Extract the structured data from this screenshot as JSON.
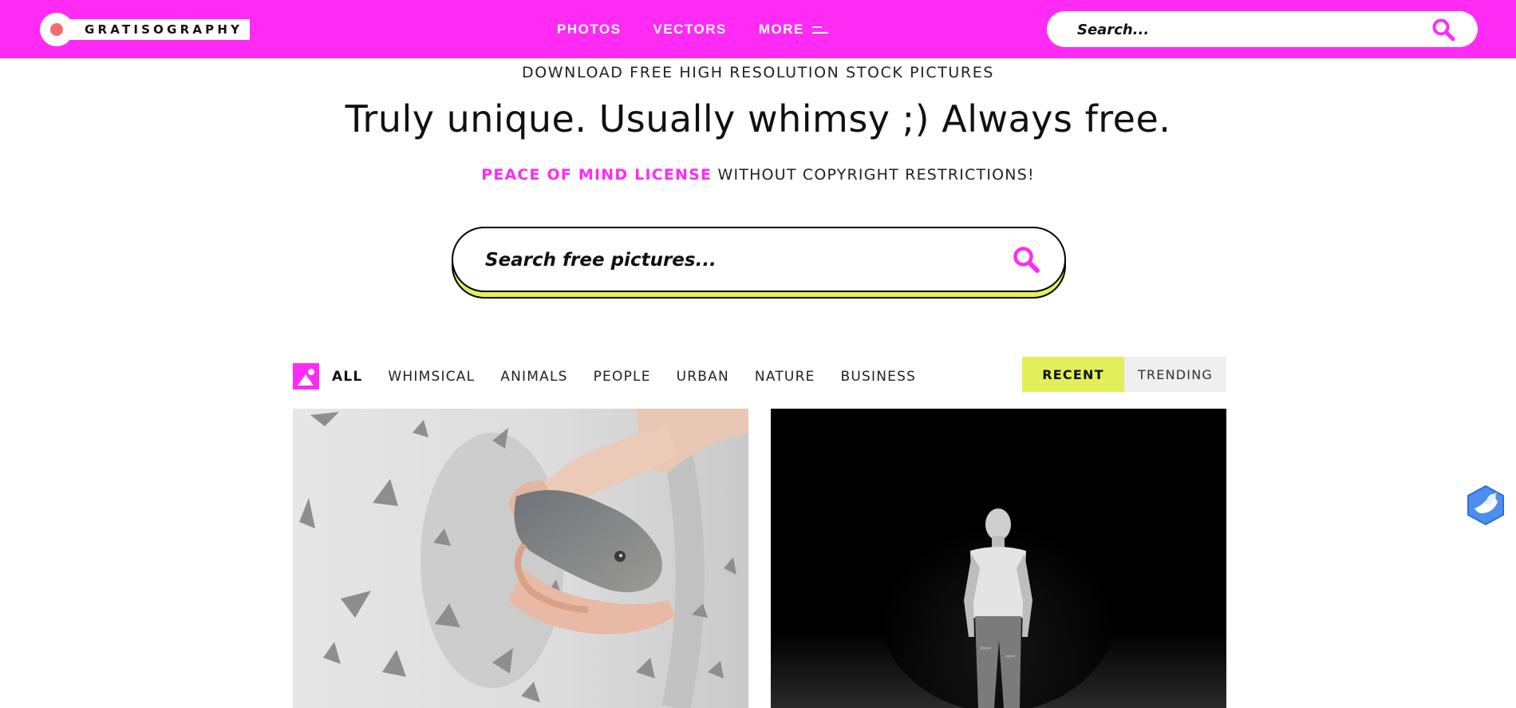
{
  "colors": {
    "brand": "#ff2bf4",
    "accent": "#e2ef5a",
    "logo_dot": "#f26d6d"
  },
  "header": {
    "logo_text": "GRATISOGRAPHY",
    "nav": {
      "photos": "PHOTOS",
      "vectors": "VECTORS",
      "more": "MORE"
    },
    "search": {
      "placeholder": "Search...",
      "icon": "search-icon"
    }
  },
  "hero": {
    "subhead": "DOWNLOAD FREE HIGH RESOLUTION STOCK PICTURES",
    "headline": "Truly unique. Usually whimsy ;) Always free.",
    "license_highlight": "PEACE OF MIND LICENSE",
    "license_rest": " WITHOUT COPYRIGHT RESTRICTIONS!",
    "search": {
      "placeholder": "Search free pictures...",
      "icon": "search-icon"
    }
  },
  "filters": {
    "category_icon": "image-icon",
    "categories": [
      {
        "label": "ALL",
        "active": true
      },
      {
        "label": "WHIMSICAL"
      },
      {
        "label": "ANIMALS"
      },
      {
        "label": "PEOPLE"
      },
      {
        "label": "URBAN"
      },
      {
        "label": "NATURE"
      },
      {
        "label": "BUSINESS"
      }
    ],
    "sort": {
      "recent": "RECENT",
      "trending": "TRENDING",
      "selected": "RECENT"
    }
  },
  "photos": [
    {
      "subject": "hands holding fish",
      "icon": "photo-hands-fish"
    },
    {
      "subject": "man standing in dark",
      "icon": "photo-man-dark"
    }
  ],
  "floating_badge": {
    "icon": "dove-badge-icon"
  }
}
